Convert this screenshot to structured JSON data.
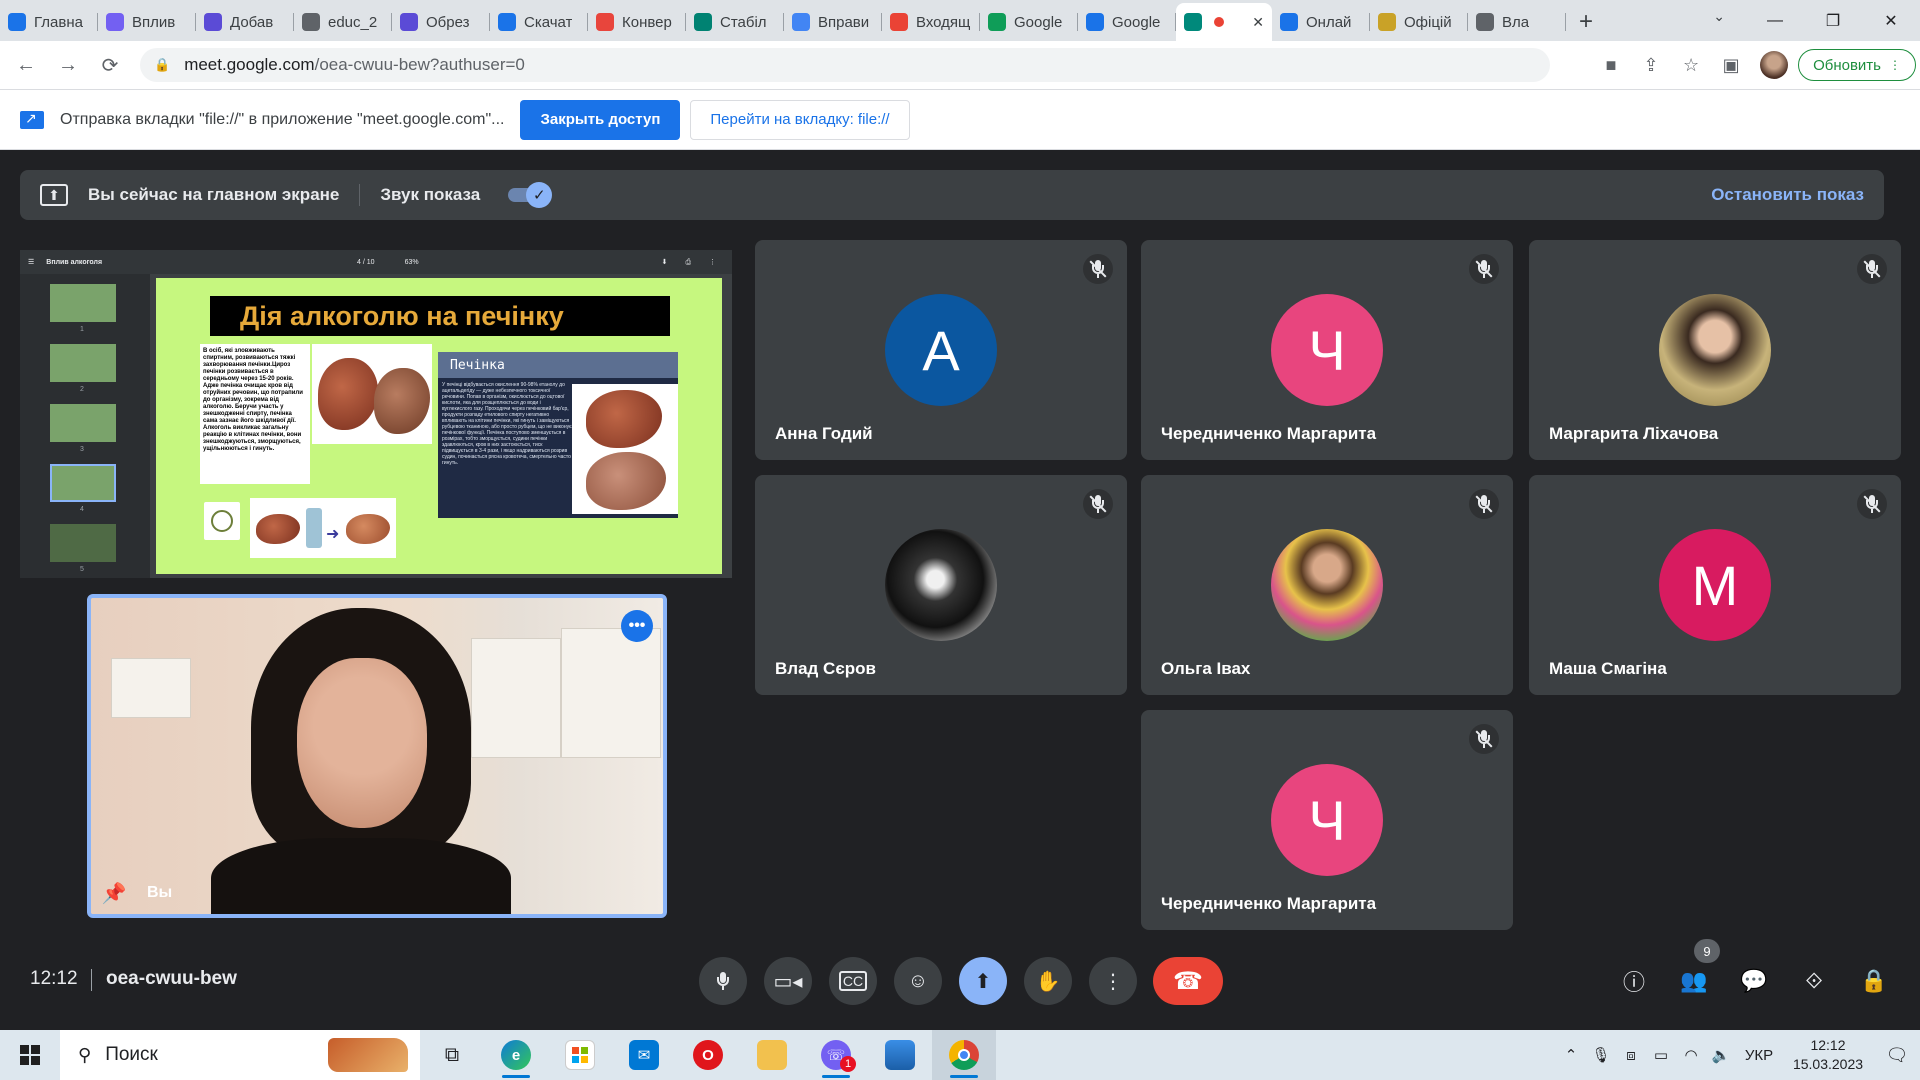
{
  "browser": {
    "tabs": [
      {
        "label": "Главна",
        "icon": "chrome-favicon",
        "color": "#1a73e8"
      },
      {
        "label": "Вплив",
        "icon": "viber-favicon",
        "color": "#7360f2"
      },
      {
        "label": "Добав",
        "icon": "shield-favicon",
        "color": "#5b4bd6"
      },
      {
        "label": "educ_2",
        "icon": "globe-favicon",
        "color": "#5f6368"
      },
      {
        "label": "Обрез",
        "icon": "shield-favicon",
        "color": "#5b4bd6"
      },
      {
        "label": "Скачат",
        "icon": "thumbs-favicon",
        "color": "#1a73e8"
      },
      {
        "label": "Конвер",
        "icon": "heart-favicon",
        "color": "#e8453c"
      },
      {
        "label": "Стабіл",
        "icon": "sway-favicon",
        "color": "#008272"
      },
      {
        "label": "Вправи",
        "icon": "a-favicon",
        "color": "#4285f4"
      },
      {
        "label": "Входящ",
        "icon": "gmail-favicon",
        "color": "#ea4335"
      },
      {
        "label": "Google",
        "icon": "classroom-favicon",
        "color": "#0f9d58"
      },
      {
        "label": "Google",
        "icon": "calendar-favicon",
        "color": "#1a73e8"
      },
      {
        "label": "",
        "icon": "meet-favicon",
        "color": "#00897b",
        "active": true
      },
      {
        "label": "Онлай",
        "icon": "o-favicon",
        "color": "#1a73e8"
      },
      {
        "label": "Офіцій",
        "icon": "crest-favicon",
        "color": "#c9a227"
      },
      {
        "label": "Вла",
        "icon": "globe-favicon",
        "color": "#5f6368"
      }
    ],
    "url_host": "meet.google.com",
    "url_path": "/oea-cwuu-bew?authuser=0",
    "update_label": "Обновить"
  },
  "infobar": {
    "message": "Отправка вкладки \"file://\" в приложение \"meet.google.com\"...",
    "stop_sharing_label": "Закрыть доступ",
    "switch_tab_label": "Перейти на вкладку: file://"
  },
  "presenting": {
    "status": "Вы сейчас на главном экране",
    "audio_label": "Звук показа",
    "audio_on": true,
    "stop_label": "Остановить показ"
  },
  "slide": {
    "viewer_title": "Вплив алкоголя",
    "page_indicator": "4 / 10",
    "zoom": "63%",
    "thumb_numbers": [
      "1",
      "2",
      "3",
      "4",
      "5"
    ],
    "title": "Дія алкоголю на печінку",
    "left_text": "В осіб, які зловживають спиртним, розвиваються тяжкі захворювання печінки.Цироз печінки розвивається в середньому через 15-20 років. Адже печінка очищає кров від отруйних речовин, що потрапили до організму, зокрема від алкоголю. Беручи участь у знешкодженні спирту, печінка сама зазнає його шкідливої дії. Алкоголь викликає загальну реакцію в клітинах печінки, вони знешкоджуються, зморщуються, ущільнюються і гинуть.",
    "panel_title": "Печінка",
    "panel_text": "У печінці відбувається окислення 90-98% етанолу до ацетальдегіду — дуже небезпечного токсичної речовини. Попав в організм, окислюється до оцтової кислоти, яка для розщеплюється до води і вуглекислого газу. Проходячи через печінковий бар'єр, продукти розпаду етилового спирту негативно впливають на клітини печінки, які гинуть і заміщуються рубцевою тканиною, або просто рубцем, що не виконує печінкової функції. Печінка поступово зменшується в розмірах, тобто зморщується, судини печінки здавлюються, кров в них застоюється, тиск підвищується в 3-4 рази, і якщо надриваються розрив судин, починається рясна кровотеча, смертельно часто гинуть."
  },
  "self_view": {
    "name": "Вы"
  },
  "participants": [
    {
      "name": "Анна Годий",
      "initial": "А",
      "color": "#0b57a0",
      "type": "initial",
      "muted": true
    },
    {
      "name": "Чередниченко Маргарита",
      "initial": "Ч",
      "color": "#e8457e",
      "type": "initial",
      "muted": true
    },
    {
      "name": "Маргарита Ліхачова",
      "initial": "",
      "color": "#8a7a4a",
      "type": "photo",
      "muted": true
    },
    {
      "name": "Влад Сєров",
      "initial": "",
      "color": "#1b1b1b",
      "type": "photo",
      "muted": true
    },
    {
      "name": "Ольга Івах",
      "initial": "",
      "color": "#b89a2a",
      "type": "photo",
      "muted": true
    },
    {
      "name": "Маша Смагіна",
      "initial": "М",
      "color": "#d81b60",
      "type": "initial",
      "muted": true
    },
    {
      "name": "Чередниченко Маргарита",
      "initial": "Ч",
      "color": "#e8457e",
      "type": "initial",
      "muted": true
    }
  ],
  "meeting": {
    "time": "12:12",
    "code": "oea-cwuu-bew",
    "participant_count": "9"
  },
  "taskbar": {
    "search_placeholder": "Поиск",
    "language": "УКР",
    "clock_time": "12:12",
    "clock_date": "15.03.2023",
    "viber_badge": "1"
  }
}
